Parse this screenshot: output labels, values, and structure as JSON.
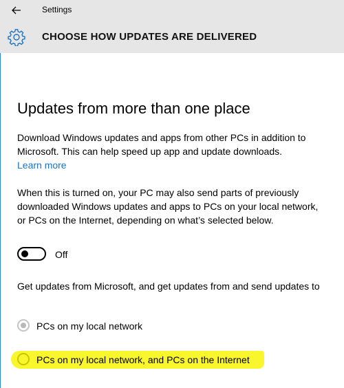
{
  "window": {
    "title": "Settings"
  },
  "header": {
    "title": "CHOOSE HOW UPDATES ARE DELIVERED",
    "icon": "gear-icon",
    "back_icon": "back-arrow-icon"
  },
  "section": {
    "title": "Updates from more than one place",
    "description": "Download Windows updates and apps from other PCs in addition to Microsoft. This can help speed up app and update downloads.",
    "learn_more": "Learn more",
    "sharing_note": "When this is turned on, your PC may also send parts of previously downloaded Windows updates and apps to PCs on your local network, or PCs on the Internet, depending on what’s selected below.",
    "toggle": {
      "state_label": "Off",
      "on": false
    },
    "radio_prompt": "Get updates from Microsoft, and get updates from and send updates to",
    "options": [
      {
        "label": "PCs on my local network",
        "selected": true,
        "enabled": false
      },
      {
        "label": "PCs on my local network, and PCs on the Internet",
        "selected": false,
        "enabled": false
      }
    ]
  },
  "colors": {
    "accent": "#1a73c8",
    "header_bg": "#e6e6e6",
    "highlight": "#f8f51c",
    "window_edge": "#2b88d8"
  }
}
